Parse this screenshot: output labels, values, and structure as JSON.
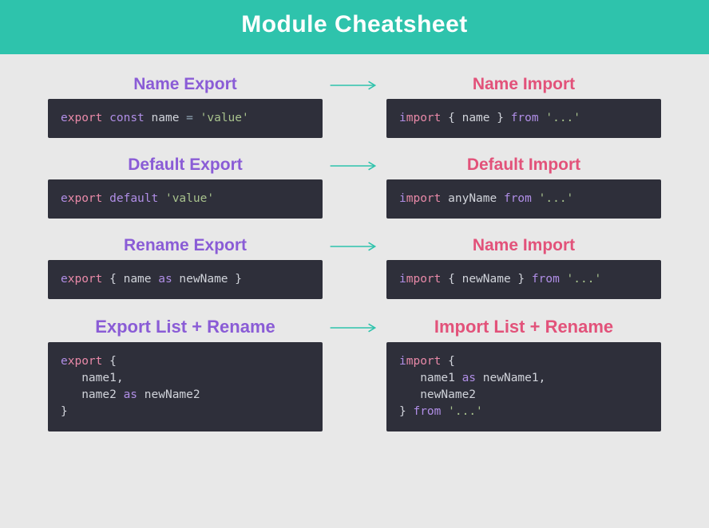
{
  "title": "Module Cheatsheet",
  "sections": [
    {
      "leftLabel": "Name Export",
      "rightLabel": "Name Import",
      "exportCode": [
        [
          {
            "t": "e",
            "c": "kw"
          },
          {
            "t": "xport ",
            "c": "pink"
          },
          {
            "t": "const",
            "c": "kw2"
          },
          {
            "t": " name ",
            "c": ""
          },
          {
            "t": "=",
            "c": "op"
          },
          {
            "t": " ",
            "c": ""
          },
          {
            "t": "'value'",
            "c": "str"
          }
        ]
      ],
      "importCode": [
        [
          {
            "t": "i",
            "c": "kw"
          },
          {
            "t": "mport ",
            "c": "pink"
          },
          {
            "t": "{ name } ",
            "c": ""
          },
          {
            "t": "from",
            "c": "kw2"
          },
          {
            "t": " ",
            "c": ""
          },
          {
            "t": "'...'",
            "c": "str"
          }
        ]
      ]
    },
    {
      "leftLabel": "Default Export",
      "rightLabel": "Default Import",
      "exportCode": [
        [
          {
            "t": "e",
            "c": "kw"
          },
          {
            "t": "xport ",
            "c": "pink"
          },
          {
            "t": "default",
            "c": "kw2"
          },
          {
            "t": " ",
            "c": ""
          },
          {
            "t": "'value'",
            "c": "str"
          }
        ]
      ],
      "importCode": [
        [
          {
            "t": "i",
            "c": "kw"
          },
          {
            "t": "mport ",
            "c": "pink"
          },
          {
            "t": "anyName ",
            "c": ""
          },
          {
            "t": "from",
            "c": "kw2"
          },
          {
            "t": " ",
            "c": ""
          },
          {
            "t": "'...'",
            "c": "str"
          }
        ]
      ]
    },
    {
      "leftLabel": "Rename Export",
      "rightLabel": "Name Import",
      "exportCode": [
        [
          {
            "t": "e",
            "c": "kw"
          },
          {
            "t": "xport ",
            "c": "pink"
          },
          {
            "t": "{ name ",
            "c": ""
          },
          {
            "t": "as",
            "c": "kw2"
          },
          {
            "t": " newName }",
            "c": ""
          }
        ]
      ],
      "importCode": [
        [
          {
            "t": "i",
            "c": "kw"
          },
          {
            "t": "mport ",
            "c": "pink"
          },
          {
            "t": "{ newName } ",
            "c": ""
          },
          {
            "t": "from",
            "c": "kw2"
          },
          {
            "t": " ",
            "c": ""
          },
          {
            "t": "'...'",
            "c": "str"
          }
        ]
      ]
    },
    {
      "leftLabel": "Export List + Rename",
      "rightLabel": "Import List + Rename",
      "big": true,
      "exportCode": [
        [
          {
            "t": "e",
            "c": "kw"
          },
          {
            "t": "xport ",
            "c": "pink"
          },
          {
            "t": "{",
            "c": ""
          }
        ],
        [
          {
            "t": "   name1,",
            "c": ""
          }
        ],
        [
          {
            "t": "   name2 ",
            "c": ""
          },
          {
            "t": "as",
            "c": "kw2"
          },
          {
            "t": " newName2",
            "c": ""
          }
        ],
        [
          {
            "t": "}",
            "c": ""
          }
        ]
      ],
      "importCode": [
        [
          {
            "t": "i",
            "c": "kw"
          },
          {
            "t": "mport ",
            "c": "pink"
          },
          {
            "t": "{",
            "c": ""
          }
        ],
        [
          {
            "t": "   name1 ",
            "c": ""
          },
          {
            "t": "as",
            "c": "kw2"
          },
          {
            "t": " newName1,",
            "c": ""
          }
        ],
        [
          {
            "t": "   newName2",
            "c": ""
          }
        ],
        [
          {
            "t": "} ",
            "c": ""
          },
          {
            "t": "from",
            "c": "kw2"
          },
          {
            "t": " ",
            "c": ""
          },
          {
            "t": "'...'",
            "c": "str"
          }
        ]
      ]
    }
  ]
}
